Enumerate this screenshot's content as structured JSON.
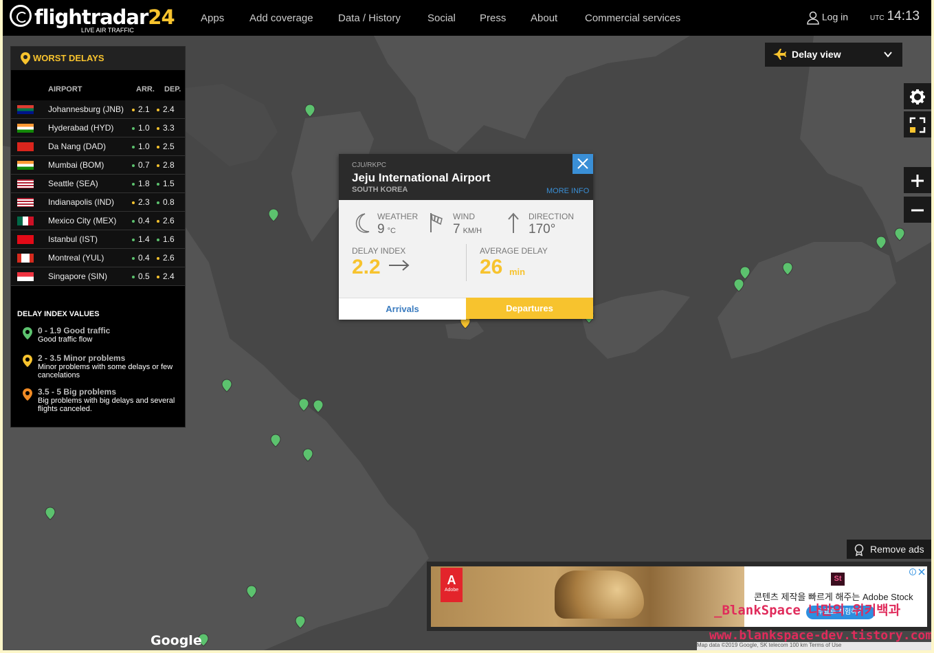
{
  "header": {
    "logo_name": "flightradar",
    "logo_num": "24",
    "logo_tag": "LIVE AIR TRAFFIC",
    "nav": [
      "Apps",
      "Add coverage",
      "Data / History",
      "Social",
      "Press",
      "About",
      "Commercial services"
    ],
    "login": "Log in",
    "utc_label": "UTC",
    "utc_time": "14:13"
  },
  "delays": {
    "title": "WORST DELAYS",
    "col_airport": "AIRPORT",
    "col_arr": "ARR.",
    "col_dep": "DEP.",
    "rows": [
      {
        "airport": "Johannesburg (JNB)",
        "arr": "2.1",
        "dep": "2.4",
        "arr_color": "#f7c32e",
        "dep_color": "#f7c32e"
      },
      {
        "airport": "Hyderabad (HYD)",
        "arr": "1.0",
        "dep": "3.3",
        "arr_color": "#5cc26e",
        "dep_color": "#f7c32e"
      },
      {
        "airport": "Da Nang (DAD)",
        "arr": "1.0",
        "dep": "2.5",
        "arr_color": "#5cc26e",
        "dep_color": "#f7c32e"
      },
      {
        "airport": "Mumbai (BOM)",
        "arr": "0.7",
        "dep": "2.8",
        "arr_color": "#5cc26e",
        "dep_color": "#f7c32e"
      },
      {
        "airport": "Seattle (SEA)",
        "arr": "1.8",
        "dep": "1.5",
        "arr_color": "#5cc26e",
        "dep_color": "#5cc26e"
      },
      {
        "airport": "Indianapolis (IND)",
        "arr": "2.3",
        "dep": "0.8",
        "arr_color": "#f7c32e",
        "dep_color": "#5cc26e"
      },
      {
        "airport": "Mexico City (MEX)",
        "arr": "0.4",
        "dep": "2.6",
        "arr_color": "#5cc26e",
        "dep_color": "#f7c32e"
      },
      {
        "airport": "Istanbul (IST)",
        "arr": "1.4",
        "dep": "1.6",
        "arr_color": "#5cc26e",
        "dep_color": "#5cc26e"
      },
      {
        "airport": "Montreal (YUL)",
        "arr": "0.4",
        "dep": "2.6",
        "arr_color": "#5cc26e",
        "dep_color": "#f7c32e"
      },
      {
        "airport": "Singapore (SIN)",
        "arr": "0.5",
        "dep": "2.4",
        "arr_color": "#5cc26e",
        "dep_color": "#f7c32e"
      }
    ],
    "legend_title": "DELAY INDEX VALUES",
    "legend": [
      {
        "range": "0 - 1.9 Good traffic",
        "desc": "Good traffic flow",
        "color": "#5cc26e"
      },
      {
        "range": "2 - 3.5 Minor problems",
        "desc": "Minor problems with some delays or few cancelations",
        "color": "#f7c32e"
      },
      {
        "range": "3.5 - 5 Big problems",
        "desc": "Big problems with big delays and several flights canceled.",
        "color": "#f08a24"
      }
    ]
  },
  "delay_view": {
    "label": "Delay view"
  },
  "popup": {
    "code": "CJU/RKPC",
    "name": "Jeju International Airport",
    "country": "SOUTH KOREA",
    "more_info": "MORE INFO",
    "weather_label": "WEATHER",
    "weather_value": "9",
    "weather_unit": "°C",
    "wind_label": "WIND",
    "wind_value": "7",
    "wind_unit": "KM/H",
    "direction_label": "DIRECTION",
    "direction_value": "170°",
    "delay_index_label": "DELAY INDEX",
    "delay_index_value": "2.2",
    "avg_delay_label": "AVERAGE DELAY",
    "avg_delay_value": "26",
    "avg_delay_unit": "min",
    "tab_arrivals": "Arrivals",
    "tab_departures": "Departures"
  },
  "ads": {
    "remove_ads": "Remove ads",
    "ad_text": "콘텐츠 제작을 빠르게 해주는 Adobe Stock",
    "ad_button": "무료로 체험하기",
    "adobe": "Adobe",
    "st": "St"
  },
  "map": {
    "google": "Google",
    "map_data": "Map data ©2019 Google, SK telecom   100 km            Terms of Use"
  },
  "watermark": {
    "line1": "_BlankSpace 나만의 위키백과",
    "line2": "www.blankspace-dev.tistory.com"
  },
  "colors": {
    "accent": "#f7c32e",
    "link": "#3a8fd6",
    "good": "#5cc26e"
  }
}
